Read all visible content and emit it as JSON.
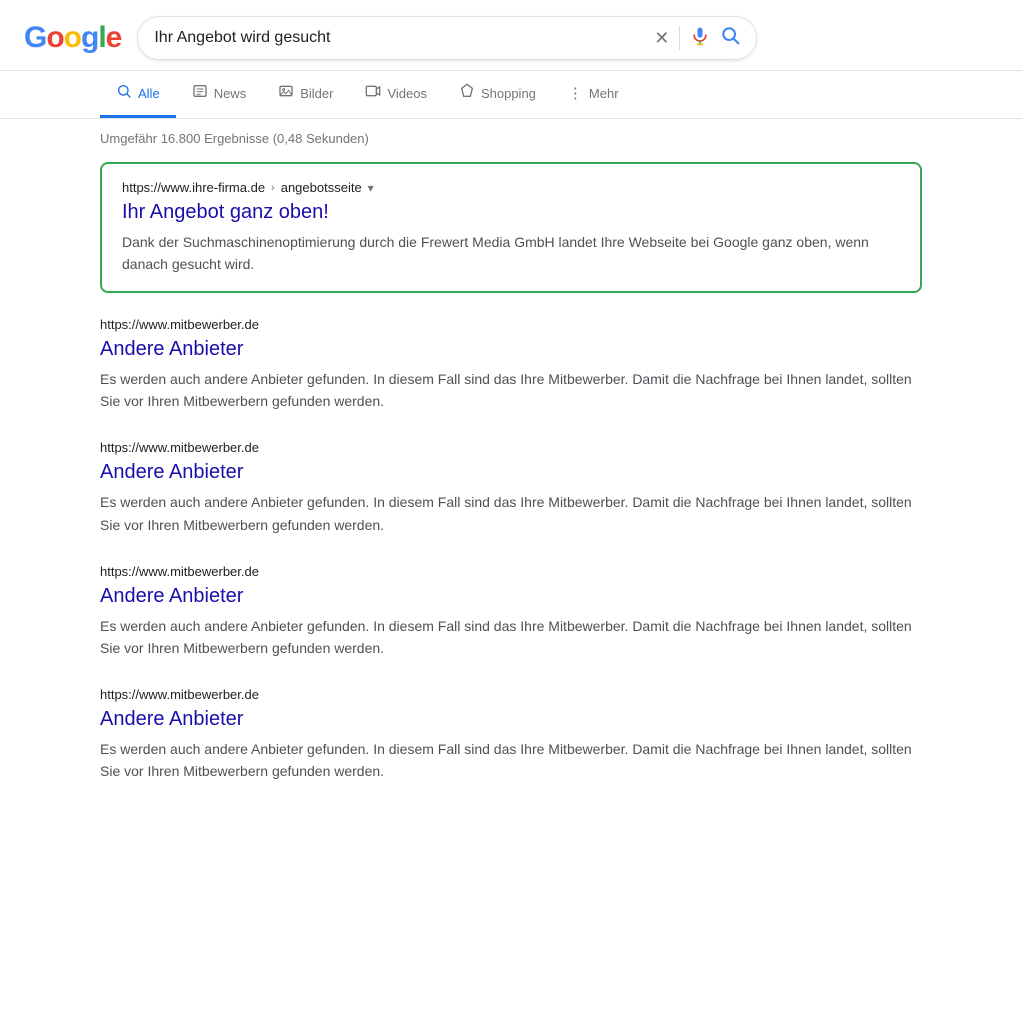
{
  "header": {
    "logo_letters": [
      "G",
      "o",
      "o",
      "g",
      "l",
      "e"
    ],
    "logo_colors": [
      "blue",
      "red",
      "yellow",
      "blue",
      "green",
      "red"
    ],
    "search_value": "Ihr Angebot wird gesucht",
    "clear_icon": "✕",
    "mic_icon": "🎤",
    "search_icon": "🔍"
  },
  "nav": {
    "tabs": [
      {
        "id": "alle",
        "label": "Alle",
        "icon": "🔍",
        "active": true
      },
      {
        "id": "news",
        "label": "News",
        "icon": "📰",
        "active": false
      },
      {
        "id": "bilder",
        "label": "Bilder",
        "icon": "🖼",
        "active": false
      },
      {
        "id": "videos",
        "label": "Videos",
        "icon": "▶",
        "active": false
      },
      {
        "id": "shopping",
        "label": "Shopping",
        "icon": "◇",
        "active": false
      },
      {
        "id": "mehr",
        "label": "Mehr",
        "icon": "⋮",
        "active": false
      }
    ]
  },
  "results_count": "Umgefähr 16.800 Ergebnisse (0,48 Sekunden)",
  "featured_result": {
    "url": "https://www.ihre-firma.de",
    "url_path": "angebotsseite",
    "title": "Ihr Angebot ganz oben!",
    "description": "Dank der Suchmaschinenoptimierung durch die Frewert Media GmbH landet Ihre Webseite bei Google ganz oben, wenn danach gesucht wird."
  },
  "results": [
    {
      "url": "https://www.mitbewerber.de",
      "title": "Andere Anbieter",
      "description": "Es werden auch andere Anbieter gefunden. In diesem Fall sind das Ihre Mitbewerber. Damit die Nachfrage bei Ihnen landet, sollten Sie vor Ihren Mitbewerbern gefunden werden."
    },
    {
      "url": "https://www.mitbewerber.de",
      "title": "Andere Anbieter",
      "description": "Es werden auch andere Anbieter gefunden. In diesem Fall sind das Ihre Mitbewerber. Damit die Nachfrage bei Ihnen landet, sollten Sie vor Ihren Mitbewerbern gefunden werden."
    },
    {
      "url": "https://www.mitbewerber.de",
      "title": "Andere Anbieter",
      "description": "Es werden auch andere Anbieter gefunden. In diesem Fall sind das Ihre Mitbewerber. Damit die Nachfrage bei Ihnen landet, sollten Sie vor Ihren Mitbewerbern gefunden werden."
    },
    {
      "url": "https://www.mitbewerber.de",
      "title": "Andere Anbieter",
      "description": "Es werden auch andere Anbieter gefunden. In diesem Fall sind das Ihre Mitbewerber. Damit die Nachfrage bei Ihnen landet, sollten Sie vor Ihren Mitbewerbern gefunden werden."
    }
  ]
}
